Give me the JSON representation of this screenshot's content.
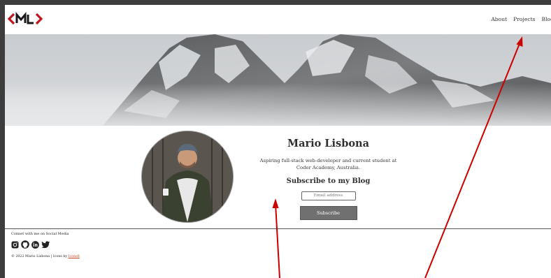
{
  "header": {
    "logo_text": "<ML>",
    "nav": [
      "About",
      "Projects",
      "Blog"
    ]
  },
  "profile": {
    "name": "Mario Lisbona",
    "bio": "Aspiring full-stack web-developer and current student at Coder Academy, Australia.",
    "subscribe_heading": "Subscribe to my Blog",
    "email_placeholder": "Email address",
    "subscribe_label": "Subscribe"
  },
  "footer": {
    "social_title": "Connet with me on Social Media",
    "social_icons": [
      "instagram-icon",
      "github-icon",
      "linkedin-icon",
      "twitter-icon"
    ],
    "copyright": "© 2022 Mario Lisbona | Icons by ",
    "icons_credit": "Icons8"
  },
  "colors": {
    "logo_red": "#c0141e",
    "arrow_red": "#cc0000",
    "button_gray": "#707070"
  }
}
